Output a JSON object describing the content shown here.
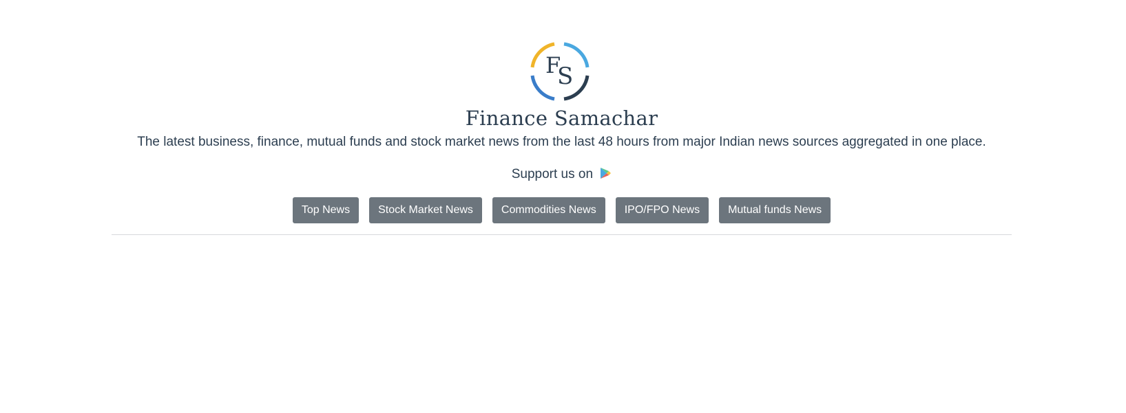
{
  "brand": {
    "logo_letters": "FS",
    "title": "Finance Samachar",
    "tagline": "The latest business, finance, mutual funds and stock market news from the last 48 hours from major Indian news sources aggregated in one place."
  },
  "support": {
    "label": "Support us on",
    "icon": "google-play-icon"
  },
  "nav": {
    "items": [
      {
        "label": "Top News"
      },
      {
        "label": "Stock Market News"
      },
      {
        "label": "Commodities News"
      },
      {
        "label": "IPO/FPO News"
      },
      {
        "label": "Mutual funds News"
      }
    ]
  },
  "colors": {
    "text": "#2c3e50",
    "button_bg": "#6c757d",
    "button_text": "#ffffff",
    "logo_yellow": "#f0b429",
    "logo_light_blue": "#4aa8e0",
    "logo_blue": "#3a7dc9",
    "logo_dark": "#2c3e50",
    "divider": "#d6d8db"
  }
}
